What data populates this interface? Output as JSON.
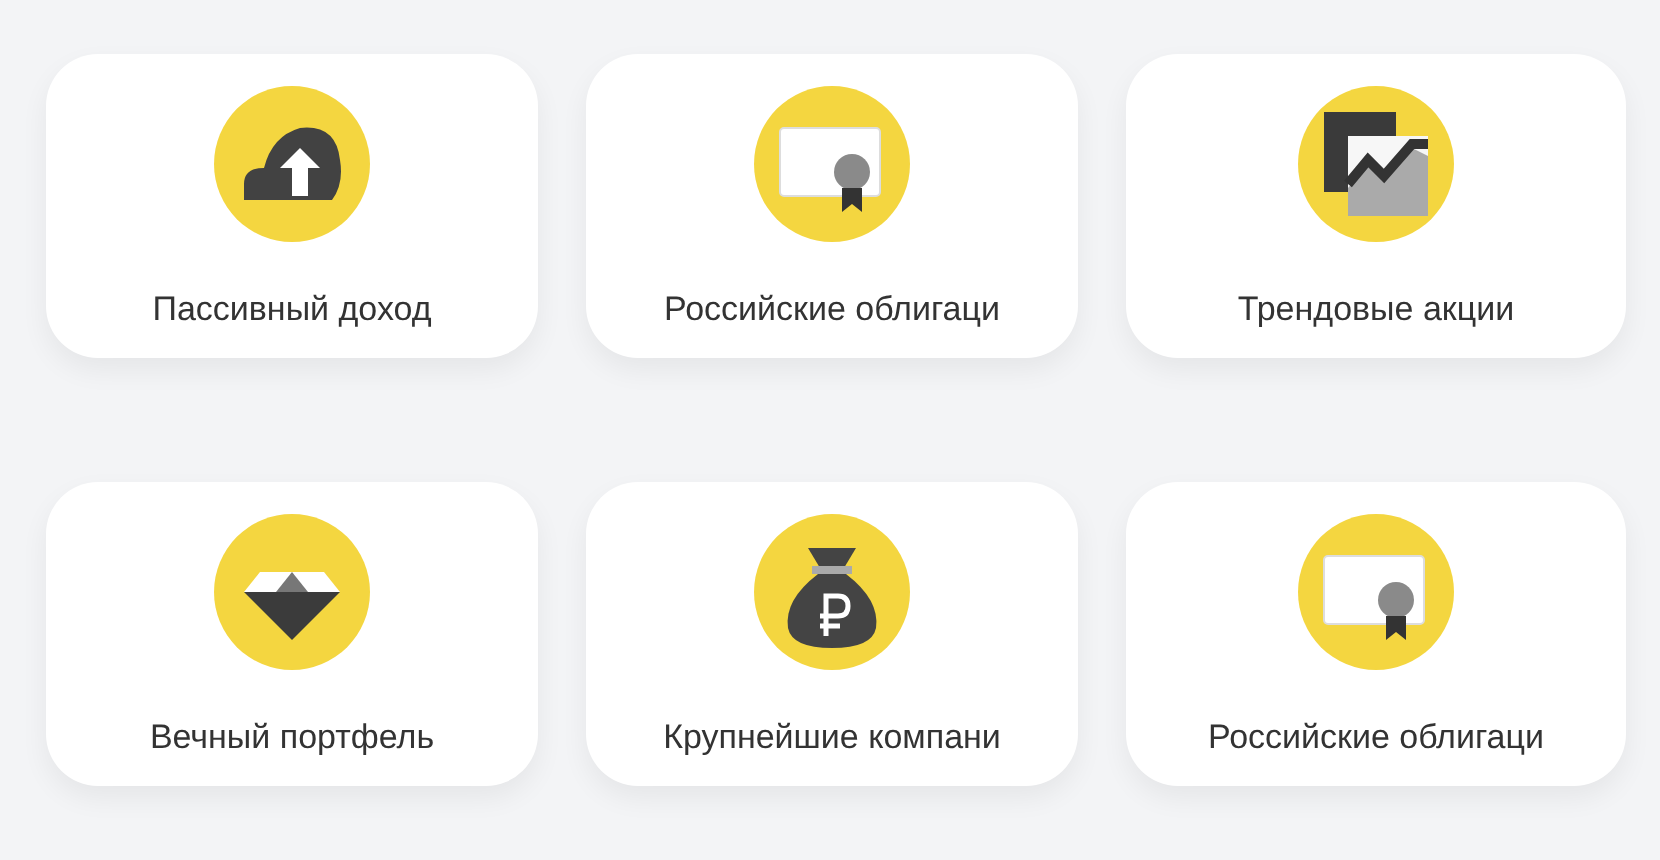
{
  "cards": [
    {
      "label": "Пассивный доход",
      "kind": "cloud"
    },
    {
      "label": "Российские облигаци",
      "kind": "certificate"
    },
    {
      "label": "Трендовые акции",
      "kind": "chart"
    },
    {
      "label": "Вечный портфель",
      "kind": "diamond"
    },
    {
      "label": "Крупнейшие компани",
      "kind": "bag"
    },
    {
      "label": "Российские облигаци",
      "kind": "certificate"
    }
  ]
}
